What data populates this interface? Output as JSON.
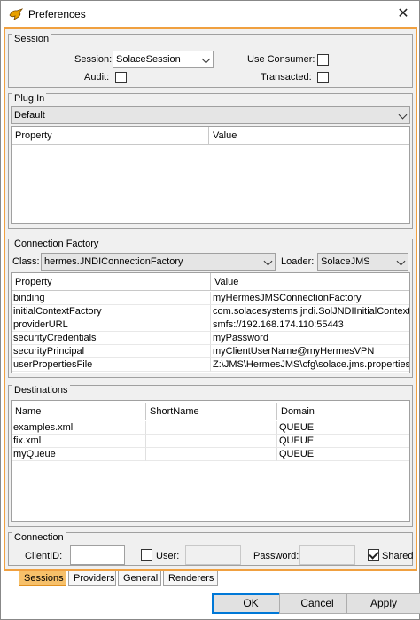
{
  "window": {
    "title": "Preferences",
    "close_glyph": "✕"
  },
  "session": {
    "group_title": "Session",
    "session_label": "Session:",
    "session_value": "SolaceSession",
    "audit_label": "Audit:",
    "use_consumer_label": "Use Consumer:",
    "transacted_label": "Transacted:"
  },
  "plugin": {
    "group_title": "Plug In",
    "selected": "Default",
    "columns": [
      "Property",
      "Value"
    ]
  },
  "connection_factory": {
    "group_title": "Connection Factory",
    "class_label": "Class:",
    "class_value": "hermes.JNDIConnectionFactory",
    "loader_label": "Loader:",
    "loader_value": "SolaceJMS",
    "columns": [
      "Property",
      "Value"
    ],
    "rows": [
      {
        "property": "binding",
        "value": "myHermesJMSConnectionFactory"
      },
      {
        "property": "initialContextFactory",
        "value": "com.solacesystems.jndi.SolJNDIInitialContext..."
      },
      {
        "property": "providerURL",
        "value": "smfs://192.168.174.110:55443"
      },
      {
        "property": "securityCredentials",
        "value": "myPassword"
      },
      {
        "property": "securityPrincipal",
        "value": "myClientUserName@myHermesVPN"
      },
      {
        "property": "userPropertiesFile",
        "value": "Z:\\JMS\\HermesJMS\\cfg\\solace.jms.properties"
      }
    ]
  },
  "destinations": {
    "group_title": "Destinations",
    "columns": [
      "Name",
      "ShortName",
      "Domain"
    ],
    "rows": [
      {
        "name": "examples.xml",
        "shortname": "",
        "domain": "QUEUE"
      },
      {
        "name": "fix.xml",
        "shortname": "",
        "domain": "QUEUE"
      },
      {
        "name": "myQueue",
        "shortname": "",
        "domain": "QUEUE"
      }
    ]
  },
  "connection": {
    "group_title": "Connection",
    "clientid_label": "ClientID:",
    "user_label": "User:",
    "password_label": "Password:",
    "shared_label": "Shared",
    "shared_checked": true
  },
  "tabs": [
    "Sessions",
    "Providers",
    "General",
    "Renderers"
  ],
  "buttons": {
    "ok": "OK",
    "cancel": "Cancel",
    "apply": "Apply"
  },
  "colors": {
    "accent": "#f0a040",
    "active_tab": "#f6c06a",
    "default_button": "#0078d7"
  }
}
